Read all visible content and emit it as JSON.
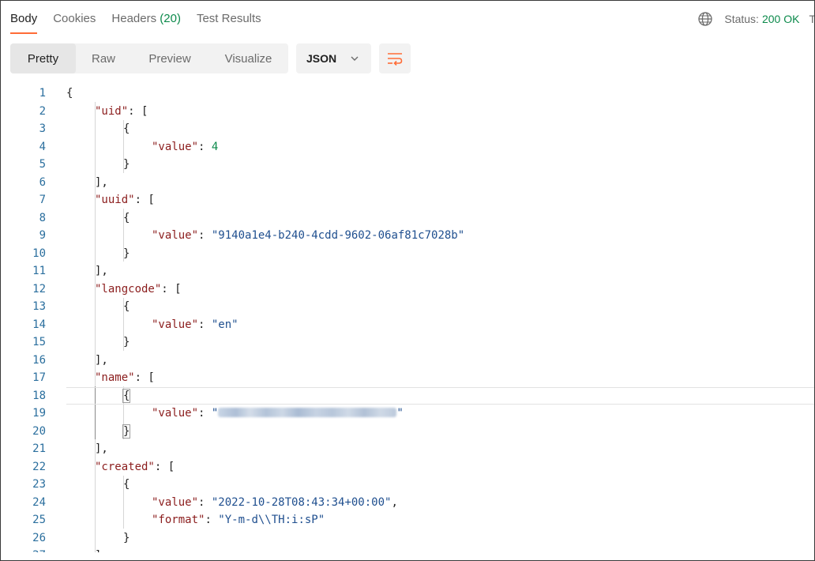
{
  "tabs": [
    {
      "label": "Body",
      "count": "",
      "active": true
    },
    {
      "label": "Cookies",
      "count": "",
      "active": false
    },
    {
      "label": "Headers",
      "count": "(20)",
      "active": false
    },
    {
      "label": "Test Results",
      "count": "",
      "active": false
    }
  ],
  "status": {
    "label": "Status:",
    "value": "200 OK",
    "extra": "T",
    "icon": "globe-icon"
  },
  "view_modes": [
    "Pretty",
    "Raw",
    "Preview",
    "Visualize"
  ],
  "format": {
    "selected": "JSON",
    "icon": "chevron-down-icon"
  },
  "wrap_icon": "wrap-lines-icon",
  "code_lines": [
    {
      "n": "1"
    },
    {
      "n": "2"
    },
    {
      "n": "3"
    },
    {
      "n": "4"
    },
    {
      "n": "5"
    },
    {
      "n": "6"
    },
    {
      "n": "7"
    },
    {
      "n": "8"
    },
    {
      "n": "9"
    },
    {
      "n": "10"
    },
    {
      "n": "11"
    },
    {
      "n": "12"
    },
    {
      "n": "13"
    },
    {
      "n": "14"
    },
    {
      "n": "15"
    },
    {
      "n": "16"
    },
    {
      "n": "17"
    },
    {
      "n": "18"
    },
    {
      "n": "19"
    },
    {
      "n": "20"
    },
    {
      "n": "21"
    },
    {
      "n": "22"
    },
    {
      "n": "23"
    },
    {
      "n": "24"
    },
    {
      "n": "25"
    },
    {
      "n": "26"
    },
    {
      "n": "27"
    }
  ],
  "json": {
    "k_uid": "\"uid\"",
    "k_uuid": "\"uuid\"",
    "k_langcode": "\"langcode\"",
    "k_name": "\"name\"",
    "k_created": "\"created\"",
    "k_value": "\"value\"",
    "k_format": "\"format\"",
    "v_uid": "4",
    "v_uuid": "\"9140a1e4-b240-4cdd-9602-06af81c7028b\"",
    "v_langcode": "\"en\"",
    "v_created": "\"2022-10-28T08:43:34+00:00\"",
    "v_format": "\"Y-m-d\\\\TH:i:sP\"",
    "open_brace": "{",
    "close_brace": "}",
    "open_bracket": "[",
    "close_bracket_comma": "],",
    "colon_bracket": ": [",
    "colon": ": ",
    "comma": ",",
    "quote": "\""
  }
}
